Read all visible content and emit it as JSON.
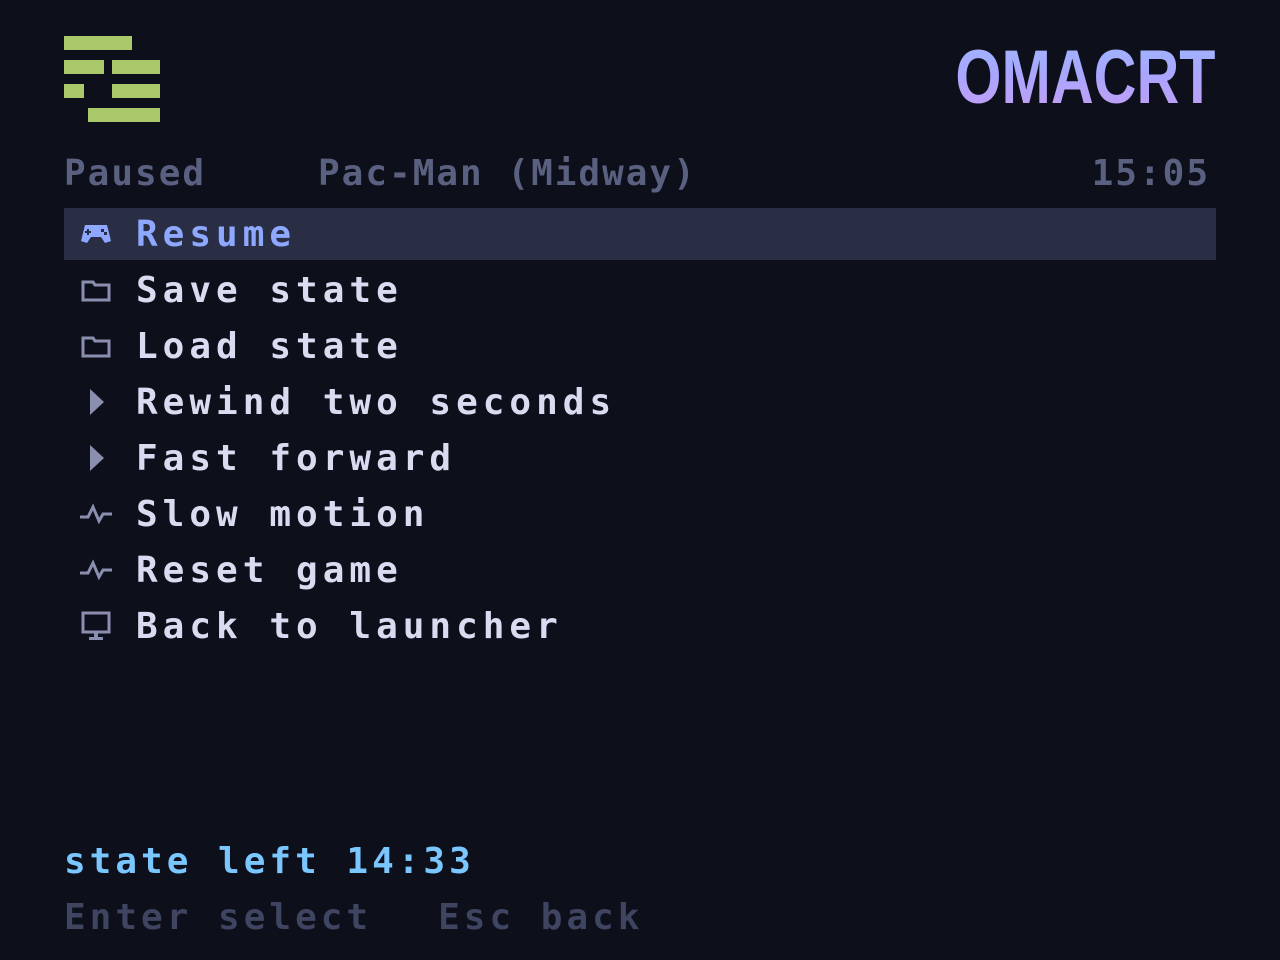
{
  "app": {
    "brand": "OMACRT",
    "logo_icon": "grid-logo-icon",
    "colors": {
      "background": "#0d0f1a",
      "logo": "#a9c96a",
      "accent": "#8ea8ff",
      "selected_bg": "#2a2e45",
      "state_text": "#7ac6ff",
      "muted": "#5a6080"
    }
  },
  "status": {
    "state": "Paused",
    "game": "Pac-Man (Midway)",
    "clock": "15:05"
  },
  "menu": {
    "selected_index": 0,
    "items": [
      {
        "label": "Resume",
        "icon": "gamepad-icon"
      },
      {
        "label": "Save state",
        "icon": "folder-icon"
      },
      {
        "label": "Load state",
        "icon": "folder-icon"
      },
      {
        "label": "Rewind two seconds",
        "icon": "play-triangle-icon"
      },
      {
        "label": "Fast forward",
        "icon": "play-triangle-icon"
      },
      {
        "label": "Slow motion",
        "icon": "pulse-icon"
      },
      {
        "label": "Reset game",
        "icon": "pulse-icon"
      },
      {
        "label": "Back to launcher",
        "icon": "monitor-icon"
      }
    ]
  },
  "footer": {
    "state_info": "state left 14:33",
    "hint_enter": "Enter select",
    "hint_esc": "Esc back"
  }
}
